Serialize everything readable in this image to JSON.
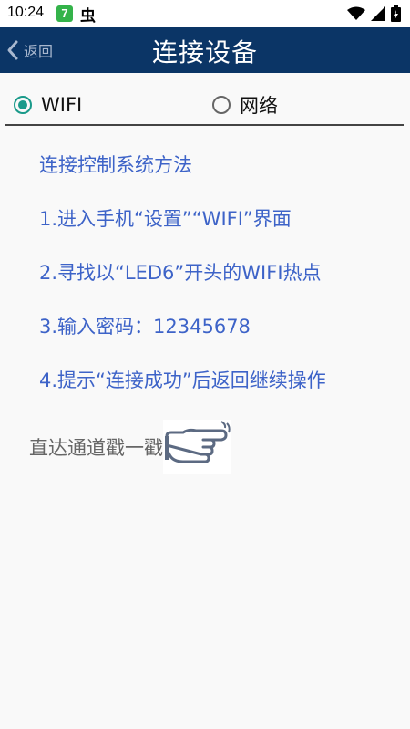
{
  "status_bar": {
    "time": "10:24",
    "app_badge": "7",
    "worm_glyph": "虫",
    "icons": [
      "wifi-icon",
      "signal-icon",
      "battery-icon"
    ]
  },
  "nav": {
    "back_label": "返回",
    "title": "连接设备"
  },
  "connection_type": {
    "options": [
      {
        "label": "WIFI",
        "selected": true
      },
      {
        "label": "网络",
        "selected": false
      }
    ]
  },
  "instructions": {
    "heading": "连接控制系统方法",
    "steps": [
      "1.进入手机“设置”“WIFI”界面",
      "2.寻找以“LED6”开头的WIFI热点",
      "3.输入密码：12345678",
      "4.提示“连接成功”后返回继续操作"
    ]
  },
  "shortcut": {
    "label": "直达通道戳一戳",
    "icon": "pointing-hand-icon"
  },
  "colors": {
    "nav_background": "#0b3566",
    "instruction_text": "#3d63c8",
    "radio_accent": "#1a9a8a",
    "page_background": "#f9f9f9"
  }
}
